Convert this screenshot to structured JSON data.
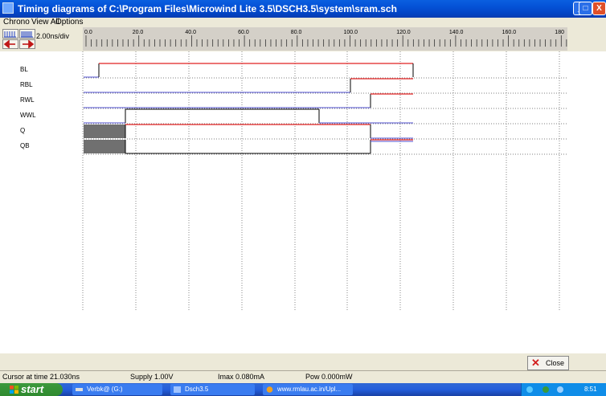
{
  "window": {
    "title": "Timing diagrams of C:\\Program Files\\Microwind Lite 3.5\\DSCH3.5\\system\\sram.sch",
    "minimize_glyph": "_",
    "maximize_glyph": "□",
    "close_glyph": "X"
  },
  "menu": [
    "Chrono",
    "View All",
    "Options"
  ],
  "toolbar": {
    "scale_label": "2.00ns/div",
    "icons": [
      "zoom-out-icon",
      "zoom-in-icon",
      "scroll-left-icon",
      "scroll-right-icon"
    ]
  },
  "ruler": {
    "ticks": [
      "0.0",
      "20.0",
      "40.0",
      "60.0",
      "80.0",
      "100.0",
      "120.0",
      "140.0",
      "160.0",
      "180"
    ]
  },
  "signals": [
    {
      "name": "BL"
    },
    {
      "name": "RBL"
    },
    {
      "name": "RWL"
    },
    {
      "name": "WWL"
    },
    {
      "name": "Q"
    },
    {
      "name": "QB"
    }
  ],
  "close_button": {
    "label": "Close"
  },
  "status": {
    "cursor": "Cursor at time 21.030ns",
    "supply": "Supply 1.00V",
    "imax": "Imax 0.080mA",
    "pow": "Pow 0.000mW"
  },
  "taskbar": {
    "start": "start",
    "tasks": [
      "Verbk@ (G:)",
      "Dsch3.5",
      "www.rmlau.ac.in/Upl..."
    ],
    "clock": "8:51 PM"
  },
  "colors": {
    "high_trace": "#e02020",
    "low_trace": "#5050d0",
    "edge": "#000000",
    "unknown_fill": "#707070"
  }
}
